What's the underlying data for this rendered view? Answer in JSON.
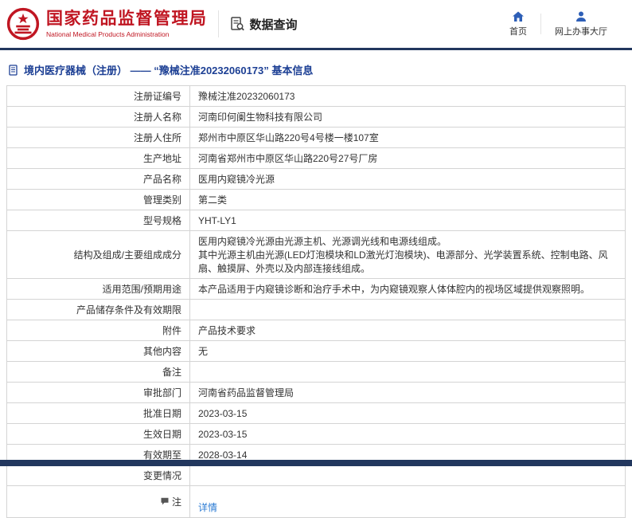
{
  "header": {
    "agency_cn": "国家药品监督管理局",
    "agency_en": "National Medical Products Administration",
    "data_query_label": "数据查询",
    "nav": [
      {
        "label": "首页"
      },
      {
        "label": "网上办事大厅"
      }
    ]
  },
  "page": {
    "title": "境内医疗器械（注册） ——  “豫械注准20232060173”  基本信息"
  },
  "colors": {
    "brand_red": "#c01622",
    "navy_bar": "#22375e",
    "title_blue": "#1c3f94",
    "link_blue": "#2b7bd3",
    "table_border": "#d4d4d4"
  },
  "table": {
    "rows": [
      {
        "label": "注册证编号",
        "value": "豫械注准20232060173"
      },
      {
        "label": "注册人名称",
        "value": "河南印何阑生物科技有限公司"
      },
      {
        "label": "注册人住所",
        "value": "郑州市中原区华山路220号4号楼一楼107室"
      },
      {
        "label": "生产地址",
        "value": "河南省郑州市中原区华山路220号27号厂房"
      },
      {
        "label": "产品名称",
        "value": "医用内窥镜冷光源"
      },
      {
        "label": "管理类别",
        "value": "第二类"
      },
      {
        "label": "型号规格",
        "value": "YHT-LY1"
      },
      {
        "label": "结构及组成/主要组成成分",
        "value": "医用内窥镜冷光源由光源主机、光源调光线和电源线组成。\n其中光源主机由光源(LED灯泡模块和LD激光灯泡模块)、电源部分、光学装置系统、控制电路、风扇、触摸屏、外壳以及内部连接线组成。"
      },
      {
        "label": "适用范围/预期用途",
        "value": "本产品适用于内窥镜诊断和治疗手术中，为内窥镜观察人体体腔内的视场区域提供观察照明。"
      },
      {
        "label": "产品储存条件及有效期限",
        "value": ""
      },
      {
        "label": "附件",
        "value": "产品技术要求"
      },
      {
        "label": "其他内容",
        "value": "无"
      },
      {
        "label": "备注",
        "value": ""
      },
      {
        "label": "审批部门",
        "value": "河南省药品监督管理局"
      },
      {
        "label": "批准日期",
        "value": "2023-03-15"
      },
      {
        "label": "生效日期",
        "value": "2023-03-15"
      },
      {
        "label": "有效期至",
        "value": "2028-03-14"
      },
      {
        "label": "变更情况",
        "value": ""
      },
      {
        "label": "注",
        "value": "详情"
      }
    ]
  }
}
